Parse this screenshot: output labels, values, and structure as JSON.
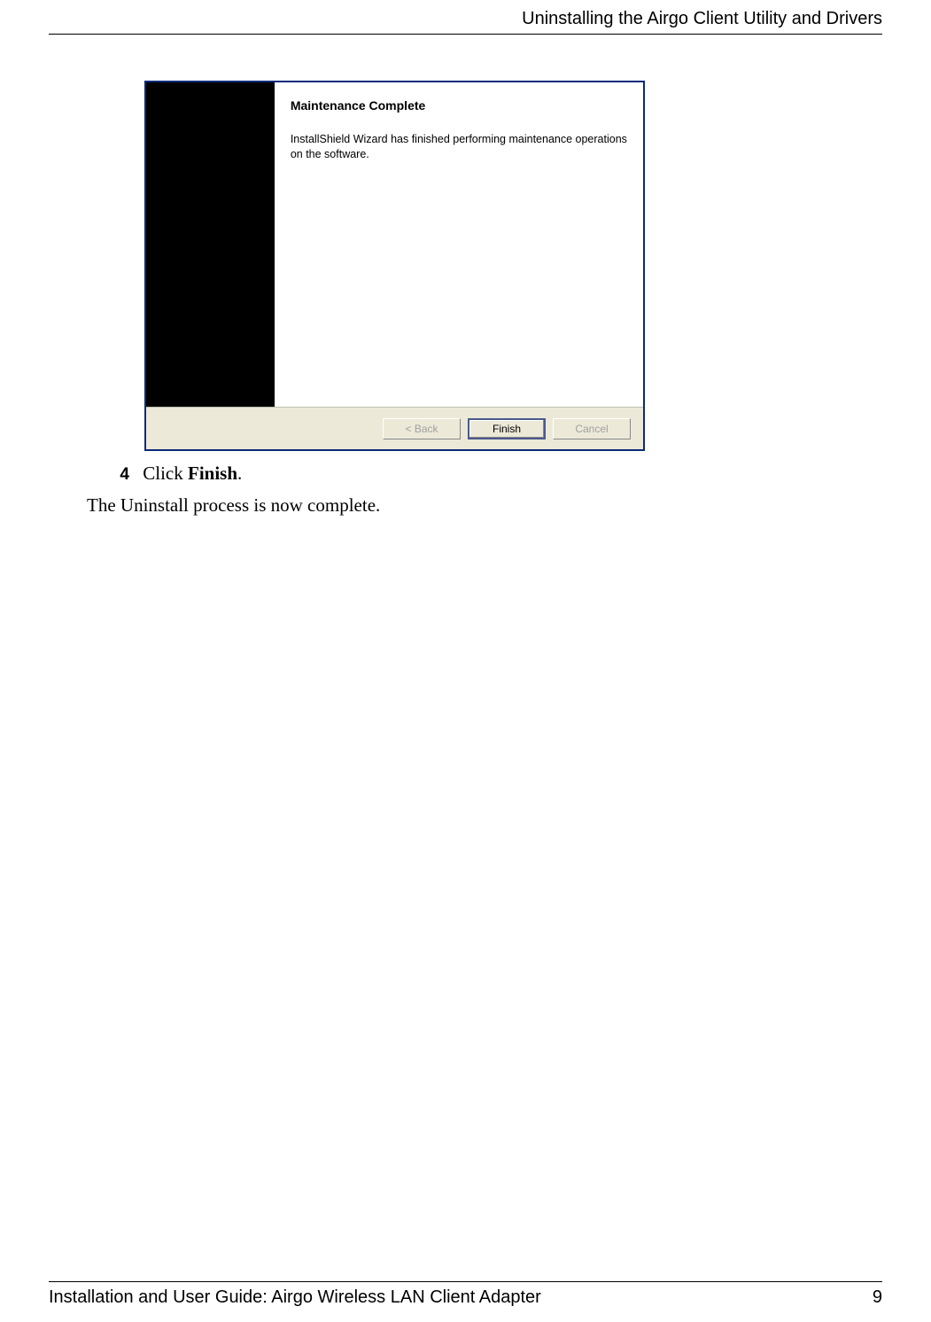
{
  "header": {
    "title": "Uninstalling the Airgo Client Utility and Drivers"
  },
  "dialog": {
    "heading": "Maintenance Complete",
    "body": "InstallShield Wizard has finished performing maintenance operations on the software.",
    "buttons": {
      "back": "< Back",
      "finish": "Finish",
      "cancel": "Cancel"
    }
  },
  "step": {
    "number": "4",
    "prefix": "Click ",
    "bold": "Finish",
    "suffix": "."
  },
  "result": "The Uninstall process is now complete.",
  "footer": {
    "left": "Installation and User Guide: Airgo Wireless LAN Client Adapter",
    "page": "9"
  }
}
